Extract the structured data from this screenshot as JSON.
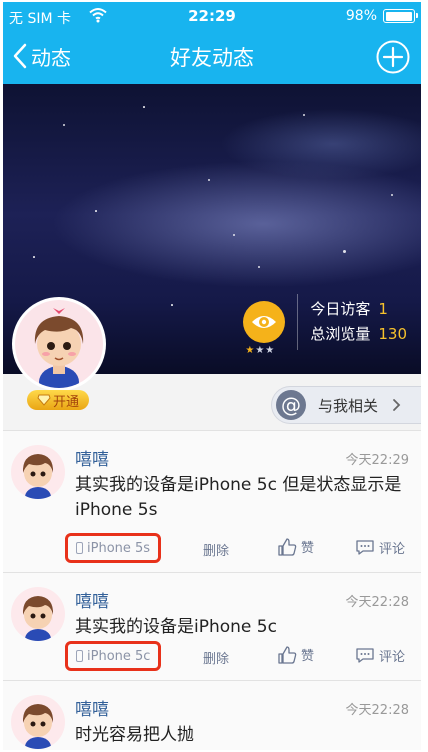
{
  "status_bar": {
    "carrier": "无 SIM 卡",
    "time": "22:29",
    "battery": "98%",
    "battery_level": 0.98
  },
  "nav": {
    "back_label": "动态",
    "title": "好友动态"
  },
  "banner": {
    "visitors_label": "今日访客",
    "visitors_value": "1",
    "views_label": "总浏览量",
    "views_value": "130",
    "eye_stars": "★★★"
  },
  "profile": {
    "vip_label": "开通"
  },
  "related": {
    "label": "与我相关"
  },
  "posts": [
    {
      "name": "嘻嘻",
      "time": "今天22:29",
      "text": "其实我的设备是iPhone 5c 但是状态显示是iPhone 5s",
      "device": "iPhone 5s",
      "delete": "删除",
      "like": "赞",
      "comment": "评论"
    },
    {
      "name": "嘻嘻",
      "time": "今天22:28",
      "text": "其实我的设备是iPhone 5c",
      "device": "iPhone 5c",
      "delete": "删除",
      "like": "赞",
      "comment": "评论"
    },
    {
      "name": "嘻嘻",
      "time": "今天22:28",
      "text": "时光容易把人抛"
    }
  ],
  "colors": {
    "header": "#18b4ef",
    "link": "#35629a",
    "highlight": "#e8311a",
    "gold": "#f5b21a"
  }
}
